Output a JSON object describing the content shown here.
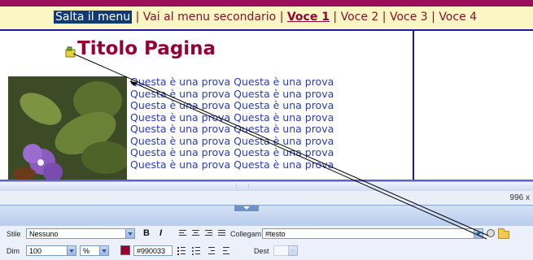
{
  "nav": {
    "skip": "Salta il menu",
    "secondary": "Vai al menu secondario",
    "voce1": "Voce 1",
    "voce2": "Voce 2",
    "voce3": "Voce 3",
    "voce4": "Voce 4",
    "separator": "|"
  },
  "page": {
    "title": "Titolo Pagina",
    "lines": [
      "Questa è una prova Questa è una prova",
      "Questa è una prova Questa è una prova",
      "Questa è una prova Questa è una prova",
      "Questa è una prova Questa è una prova",
      "Questa è una prova Questa è una prova",
      "Questa è una prova Questa è una prova",
      "Questa è una prova Questa è una prova",
      "Questa è una prova Questa è una prova"
    ]
  },
  "status": {
    "size": "996 x"
  },
  "props": {
    "stile_label": "Stile",
    "stile_value": "Nessuno",
    "bold": "B",
    "italic": "I",
    "collegam_label": "Collegam",
    "collegam_value": "#testo",
    "dim_label": "Dim",
    "dim_value": "100",
    "unit_value": "%",
    "color_value": "#990033",
    "dest_label": "Dest"
  },
  "colors": {
    "accent": "#990033",
    "nav_bg": "#fbf7c4",
    "link_text": "#2a3bc0"
  },
  "icons": [
    "cursor-marker-icon",
    "dropdown-arrow-icon",
    "align-left-icon",
    "align-center-icon",
    "align-right-icon",
    "align-justify-icon",
    "unordered-list-icon",
    "ordered-list-icon",
    "outdent-icon",
    "indent-icon",
    "point-to-file-icon",
    "browse-folder-icon"
  ]
}
